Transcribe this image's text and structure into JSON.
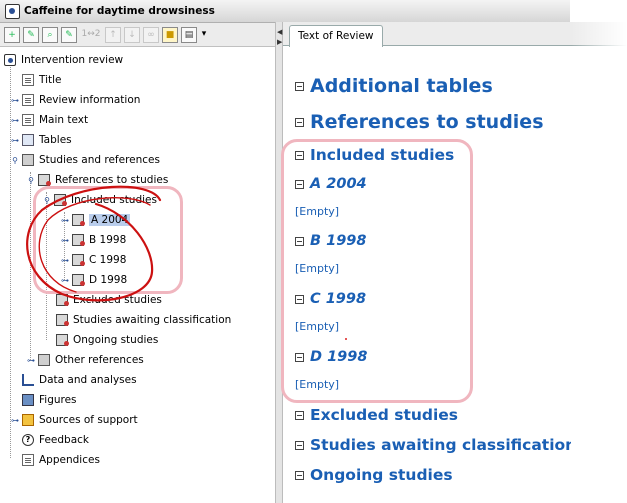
{
  "window": {
    "title": "Caffeine for daytime drowsiness",
    "icon": "review-app-icon"
  },
  "toolbar": {
    "buttons": [
      "add-icon",
      "edit-icon",
      "find-icon",
      "edit-properties-icon"
    ],
    "compare_label": "1↔2",
    "disabled": [
      "move-up-icon",
      "move-down-icon",
      "link-icon"
    ],
    "more": [
      "note-icon",
      "print-icon"
    ],
    "dropdown": "▾"
  },
  "tree": {
    "root": "Intervention review",
    "title": "Title",
    "review_information": "Review information",
    "main_text": "Main text",
    "tables": "Tables",
    "studies_and_references": "Studies and references",
    "references_to_studies": "References to studies",
    "included_studies": "Included studies",
    "studies": [
      "A 2004",
      "B 1998",
      "C 1998",
      "D 1998"
    ],
    "excluded_studies": "Excluded studies",
    "awaiting": "Studies awaiting classification",
    "ongoing": "Ongoing studies",
    "other_references": "Other references",
    "data_and_analyses": "Data and analyses",
    "figures": "Figures",
    "sources_of_support": "Sources of support",
    "feedback": "Feedback",
    "appendices": "Appendices"
  },
  "tab": {
    "label": "Text of Review"
  },
  "content": {
    "additional_tables": "Additional tables",
    "references_to_studies": "References to studies",
    "included_studies": "Included studies",
    "studies": [
      {
        "name": "A 2004",
        "body": "[Empty]"
      },
      {
        "name": "B 1998",
        "body": "[Empty]"
      },
      {
        "name": "C 1998",
        "body": "[Empty]"
      },
      {
        "name": "D 1998",
        "body": "[Empty]"
      }
    ],
    "excluded_studies": "Excluded studies",
    "awaiting": "Studies awaiting classification",
    "ongoing": "Ongoing studies"
  },
  "colors": {
    "heading": "#1a5fb4",
    "highlight": "#f0b6bf",
    "annotation": "#cc1111",
    "selection": "#b9cdec"
  }
}
